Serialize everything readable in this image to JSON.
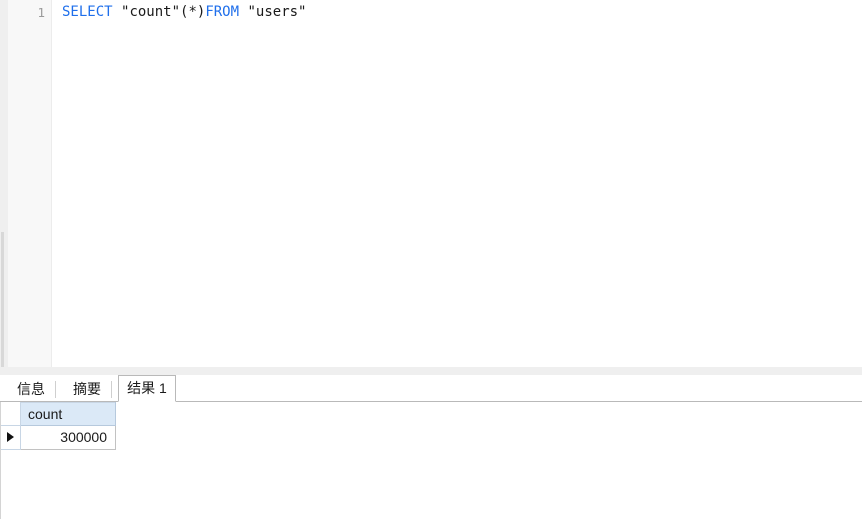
{
  "editor": {
    "line_number": "1",
    "sql_tokens": [
      {
        "text": "SELECT",
        "kind": "keyword"
      },
      {
        "text": " ",
        "kind": "plain"
      },
      {
        "text": "\"count\"",
        "kind": "identifier"
      },
      {
        "text": "(*)",
        "kind": "operator"
      },
      {
        "text": "FROM",
        "kind": "keyword"
      },
      {
        "text": " ",
        "kind": "plain"
      },
      {
        "text": "\"users\"",
        "kind": "identifier"
      }
    ],
    "sql_text": "SELECT \"count\"(*)FROM \"users\"",
    "keyword_color": "#1f6feb",
    "identifier_color": "#1a1a1a",
    "gutter_color": "#f8f8f8"
  },
  "bottom_panel": {
    "tabs": [
      {
        "label": "信息",
        "active": false
      },
      {
        "label": "摘要",
        "active": false
      },
      {
        "label": "结果 1",
        "active": true
      }
    ],
    "result_grid": {
      "columns": [
        "count"
      ],
      "rows": [
        {
          "selected": true,
          "values": [
            "300000"
          ]
        }
      ],
      "header_background": "#dbe9f7"
    }
  }
}
